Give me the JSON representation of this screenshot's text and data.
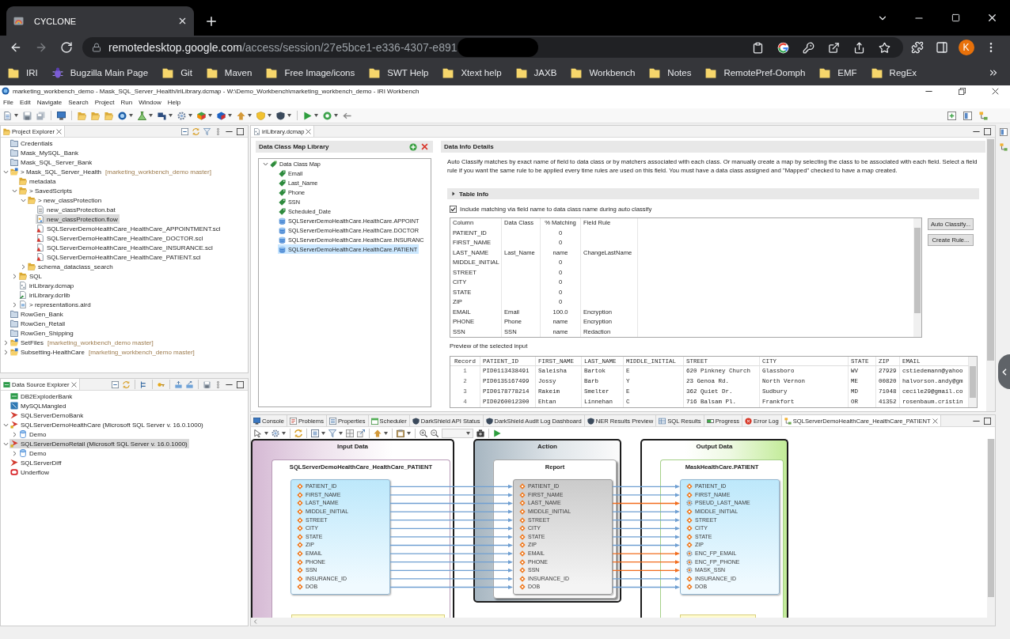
{
  "browser": {
    "tabs": [
      {
        "title": "CYCLONE",
        "selected": true
      }
    ],
    "forward_disabled": true,
    "address": {
      "host": "remotedesktop.google.com",
      "path": "/access/session/27e5bce1-e336-4307-e891"
    },
    "profile_initial": "K",
    "bookmarks": [
      {
        "label": "IRI",
        "kind": "folder"
      },
      {
        "label": "Bugzilla Main Page",
        "kind": "link"
      },
      {
        "label": "Git",
        "kind": "folder"
      },
      {
        "label": "Maven",
        "kind": "folder"
      },
      {
        "label": "Free Image/icons",
        "kind": "folder"
      },
      {
        "label": "SWT Help",
        "kind": "folder"
      },
      {
        "label": "Xtext help",
        "kind": "folder"
      },
      {
        "label": "JAXB",
        "kind": "folder"
      },
      {
        "label": "Workbench",
        "kind": "folder"
      },
      {
        "label": "Notes",
        "kind": "folder"
      },
      {
        "label": "RemotePref-Oomph",
        "kind": "folder"
      },
      {
        "label": "EMF",
        "kind": "folder"
      },
      {
        "label": "RegEx",
        "kind": "folder"
      }
    ]
  },
  "window": {
    "title": "marketing_workbench_demo - Mask_SQL_Server_Health/iriLibrary.dcmap - W:\\Demo_Workbench\\marketing_workbench_demo - IRI Workbench"
  },
  "menu": [
    "File",
    "Edit",
    "Navigate",
    "Search",
    "Project",
    "Run",
    "Window",
    "Help"
  ],
  "project_explorer": {
    "title": "Project Explorer",
    "tree": [
      {
        "label": "Credentials",
        "kind": "project",
        "selected": false
      },
      {
        "label": "Mask_MySQL_Bank",
        "kind": "project",
        "selected": false
      },
      {
        "label": "Mask_SQL_Server_Bank",
        "kind": "project",
        "selected": false
      },
      {
        "label": "> Mask_SQL_Server_Health",
        "repo": "[marketing_workbench_demo master]",
        "kind": "repo",
        "expanded": true,
        "selected": false,
        "children": [
          {
            "label": "metadata",
            "kind": "folder",
            "selected": false
          },
          {
            "label": "> SavedScripts",
            "kind": "folder",
            "expanded": true,
            "selected": false,
            "children": [
              {
                "label": "> new_classProtection",
                "kind": "folder",
                "expanded": true,
                "selected": false,
                "children": [
                  {
                    "label": "new_classProtection.bat",
                    "kind": "bat",
                    "selected": false
                  },
                  {
                    "label": "new_classProtection.flow",
                    "kind": "flow",
                    "selected": true
                  },
                  {
                    "label": "SQLServerDemoHealthCare_HealthCare_APPOINTMENT.scl",
                    "kind": "scl",
                    "selected": false
                  },
                  {
                    "label": "SQLServerDemoHealthCare_HealthCare_DOCTOR.scl",
                    "kind": "scl",
                    "selected": false
                  },
                  {
                    "label": "SQLServerDemoHealthCare_HealthCare_INSURANCE.scl",
                    "kind": "scl",
                    "selected": false
                  },
                  {
                    "label": "SQLServerDemoHealthCare_HealthCare_PATIENT.scl",
                    "kind": "scl",
                    "selected": false
                  }
                ]
              },
              {
                "label": "schema_dataclass_search",
                "kind": "folder",
                "expanded": false,
                "selected": false
              }
            ]
          },
          {
            "label": "SQL",
            "kind": "folder",
            "expanded": false,
            "selected": false
          },
          {
            "label": "iriLibrary.dcmap",
            "kind": "dcmap",
            "selected": false
          },
          {
            "label": "iriLibrary.dcrlib",
            "kind": "dcrlib",
            "selected": false
          },
          {
            "label": "> representations.aird",
            "kind": "aird",
            "expanded": false,
            "selected": false
          }
        ]
      },
      {
        "label": "RowGen_Bank",
        "kind": "project",
        "selected": false
      },
      {
        "label": "RowGen_Retail",
        "kind": "project",
        "selected": false
      },
      {
        "label": "RowGen_Shipping",
        "kind": "project",
        "selected": false
      },
      {
        "label": "SetFiles",
        "repo": "[marketing_workbench_demo master]",
        "kind": "repo",
        "expanded": false,
        "selected": false
      },
      {
        "label": "Subsetting-HealthCare",
        "repo": "[marketing_workbench_demo master]",
        "kind": "repo",
        "expanded": false,
        "selected": false
      }
    ]
  },
  "data_source_explorer": {
    "title": "Data Source Explorer",
    "tree": [
      {
        "label": "DB2ExploderBank",
        "kind": "db2",
        "selected": false
      },
      {
        "label": "MySQLMangled",
        "kind": "mysql",
        "selected": false
      },
      {
        "label": "SQLServerDemoBank",
        "kind": "sqlserver",
        "selected": false
      },
      {
        "label": "SQLServerDemoHealthCare (Microsoft SQL Server v. 16.0.1000)",
        "kind": "sqlserver-connected",
        "expanded": true,
        "selected": false,
        "children": [
          {
            "label": "Demo",
            "kind": "database",
            "expanded": false,
            "selected": false
          }
        ]
      },
      {
        "label": "SQLServerDemoRetail (Microsoft SQL Server v. 16.0.1000)",
        "kind": "sqlserver-connected",
        "expanded": true,
        "selected": true,
        "children": [
          {
            "label": "Demo",
            "kind": "database",
            "expanded": false,
            "selected": false
          }
        ]
      },
      {
        "label": "SQLServerDiff",
        "kind": "sqlserver",
        "selected": false
      },
      {
        "label": "Underflow",
        "kind": "oracle",
        "selected": false
      }
    ]
  },
  "editor": {
    "tabs": [
      {
        "title": "iriLibrary.dcmap",
        "selected": true
      }
    ],
    "library": {
      "title": "Data Class Map Library",
      "tree": [
        {
          "label": "Data Class Map",
          "kind": "map",
          "expanded": true,
          "selected": false,
          "children": [
            {
              "label": "Email",
              "kind": "class",
              "selected": false
            },
            {
              "label": "Last_Name",
              "kind": "class",
              "selected": false
            },
            {
              "label": "Phone",
              "kind": "class",
              "selected": false
            },
            {
              "label": "SSN",
              "kind": "class",
              "selected": false
            },
            {
              "label": "Scheduled_Date",
              "kind": "class",
              "selected": false
            },
            {
              "label": "SQLServerDemoHealthCare.HealthCare.APPOINT",
              "kind": "table",
              "selected": false
            },
            {
              "label": "SQLServerDemoHealthCare.HealthCare.DOCTOR",
              "kind": "table",
              "selected": false
            },
            {
              "label": "SQLServerDemoHealthCare.HealthCare.INSURANC",
              "kind": "table",
              "selected": false
            },
            {
              "label": "SQLServerDemoHealthCare.HealthCare.PATIENT",
              "kind": "table",
              "selected": true
            }
          ]
        }
      ]
    },
    "details": {
      "title": "Data Info Details",
      "description": "Auto Classify matches by exact name of field to data class or by matchers associated with each class. Or manually create a map by selecting the class to be associated with each field. Select a field rule if you want the same rule to be applied every time rules are used on this field. You must have a data class assigned and \"Mapped\" checked to have a map created.",
      "section": {
        "title": "Table Info",
        "expanded": false
      },
      "include_matching": {
        "label": "Include matching via field name to data class name during auto classify",
        "checked": true
      },
      "table": {
        "columns": [
          "Column",
          "Data Class",
          "% Matching",
          "Field Rule"
        ],
        "rows": [
          {
            "column": "PATIENT_ID",
            "matching": "0"
          },
          {
            "column": "FIRST_NAME",
            "matching": "0"
          },
          {
            "column": "LAST_NAME",
            "data_class": "Last_Name",
            "matching": "name",
            "field_rule": "ChangeLastName"
          },
          {
            "column": "MIDDLE_INITIAL",
            "matching": "0"
          },
          {
            "column": "STREET",
            "matching": "0"
          },
          {
            "column": "CITY",
            "matching": "0"
          },
          {
            "column": "STATE",
            "matching": "0"
          },
          {
            "column": "ZIP",
            "matching": "0"
          },
          {
            "column": "EMAIL",
            "data_class": "Email",
            "matching": "100.0",
            "field_rule": "Encryption"
          },
          {
            "column": "PHONE",
            "data_class": "Phone",
            "matching": "name",
            "field_rule": "Encryption"
          },
          {
            "column": "SSN",
            "data_class": "SSN",
            "matching": "name",
            "field_rule": "Redaction"
          }
        ]
      },
      "buttons": [
        "Auto Classify...",
        "Create Rule..."
      ],
      "preview": {
        "label": "Preview of the selected input",
        "columns": [
          "Record",
          "PATIENT_ID",
          "FIRST_NAME",
          "LAST_NAME",
          "MIDDLE_INITIAL",
          "STREET",
          "CITY",
          "STATE",
          "ZIP",
          "EMAIL"
        ],
        "rows": [
          [
            "1",
            "PID0113438491",
            "Saleisha",
            "Bartok",
            "E",
            "620 Pinkney Church",
            "Glassboro",
            "WV",
            "27929",
            "cstiedemann@yahoo"
          ],
          [
            "2",
            "PID0135167499",
            "Jossy",
            "Barb",
            "Y",
            "23 Genoa Rd.",
            "North Vernon",
            "ME",
            "00820",
            "halvorson.andy@gm"
          ],
          [
            "3",
            "PID0178778214",
            "Rakeim",
            "Smelter",
            "E",
            "362 Quiet Dr.",
            "Sudbury",
            "MD",
            "71048",
            "cecile29@gmail.co"
          ],
          [
            "4",
            "PID0260012300",
            "Ehtan",
            "Linnehan",
            "C",
            "716 Balsam Pl.",
            "Frankfort",
            "OR",
            "41352",
            "rosenbaum.cristin"
          ]
        ]
      }
    }
  },
  "bottom_panel": {
    "tabs": [
      {
        "title": "Console",
        "selected": false
      },
      {
        "title": "Problems",
        "selected": false
      },
      {
        "title": "Properties",
        "selected": false
      },
      {
        "title": "Scheduler",
        "selected": false
      },
      {
        "title": "DarkShield API Status",
        "selected": false
      },
      {
        "title": "DarkShield Audit Log Dashboard",
        "selected": false
      },
      {
        "title": "NER Results Preview",
        "selected": false
      },
      {
        "title": "SQL Results",
        "selected": false
      },
      {
        "title": "Progress",
        "selected": false
      },
      {
        "title": "Error Log",
        "selected": false
      },
      {
        "title": "SQLServerDemoHealthCare_HealthCare_PATIENT",
        "selected": true
      }
    ],
    "flow": {
      "columns": [
        {
          "title": "Input Data",
          "kind": "input",
          "node": {
            "title": "SQLServerDemoHealthCare_HealthCare_PATIENT",
            "fields": [
              {
                "name": "PATIENT_ID",
                "kind": "field"
              },
              {
                "name": "FIRST_NAME",
                "kind": "field"
              },
              {
                "name": "LAST_NAME",
                "kind": "field"
              },
              {
                "name": "MIDDLE_INITIAL",
                "kind": "field"
              },
              {
                "name": "STREET",
                "kind": "field"
              },
              {
                "name": "CITY",
                "kind": "field"
              },
              {
                "name": "STATE",
                "kind": "field"
              },
              {
                "name": "ZIP",
                "kind": "field"
              },
              {
                "name": "EMAIL",
                "kind": "field"
              },
              {
                "name": "PHONE",
                "kind": "field"
              },
              {
                "name": "SSN",
                "kind": "field"
              },
              {
                "name": "INSURANCE_ID",
                "kind": "field"
              },
              {
                "name": "DOB",
                "kind": "field"
              }
            ]
          }
        },
        {
          "title": "Action",
          "kind": "action",
          "node": {
            "title": "Report",
            "fields": [
              {
                "name": "PATIENT_ID",
                "kind": "field"
              },
              {
                "name": "FIRST_NAME",
                "kind": "field"
              },
              {
                "name": "LAST_NAME",
                "kind": "field"
              },
              {
                "name": "MIDDLE_INITIAL",
                "kind": "field"
              },
              {
                "name": "STREET",
                "kind": "field"
              },
              {
                "name": "CITY",
                "kind": "field"
              },
              {
                "name": "STATE",
                "kind": "field"
              },
              {
                "name": "ZIP",
                "kind": "field"
              },
              {
                "name": "EMAIL",
                "kind": "field"
              },
              {
                "name": "PHONE",
                "kind": "field"
              },
              {
                "name": "SSN",
                "kind": "field"
              },
              {
                "name": "INSURANCE_ID",
                "kind": "field"
              },
              {
                "name": "DOB",
                "kind": "field"
              }
            ]
          }
        },
        {
          "title": "Output Data",
          "kind": "output",
          "node": {
            "title": "MaskHealthCare.PATIENT",
            "fields": [
              {
                "name": "PATIENT_ID",
                "kind": "field"
              },
              {
                "name": "FIRST_NAME",
                "kind": "field"
              },
              {
                "name": "PSEUD_LAST_NAME",
                "kind": "rule"
              },
              {
                "name": "MIDDLE_INITIAL",
                "kind": "field"
              },
              {
                "name": "STREET",
                "kind": "field"
              },
              {
                "name": "CITY",
                "kind": "field"
              },
              {
                "name": "STATE",
                "kind": "field"
              },
              {
                "name": "ZIP",
                "kind": "field"
              },
              {
                "name": "ENC_FP_EMAIL",
                "kind": "rule"
              },
              {
                "name": "ENC_FP_PHONE",
                "kind": "rule"
              },
              {
                "name": "MASK_SSN",
                "kind": "rule"
              },
              {
                "name": "INSURANCE_ID",
                "kind": "field"
              },
              {
                "name": "DOB",
                "kind": "field"
              }
            ]
          }
        }
      ]
    }
  }
}
